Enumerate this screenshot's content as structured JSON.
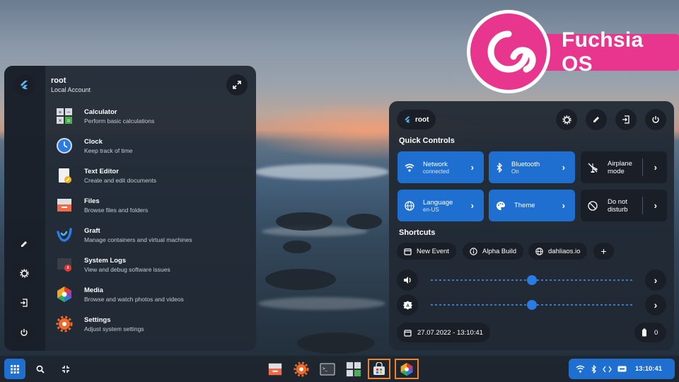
{
  "brand": {
    "logo_text": "Fuchsia OS",
    "color": "#e8368f"
  },
  "launcher": {
    "user_name": "root",
    "user_subtitle": "Local Account",
    "apps": [
      {
        "name": "Calculator",
        "desc": "Perform basic calculations",
        "icon": "calculator-icon"
      },
      {
        "name": "Clock",
        "desc": "Keep track of time",
        "icon": "clock-icon"
      },
      {
        "name": "Text Editor",
        "desc": "Create and edit documents",
        "icon": "text-editor-icon"
      },
      {
        "name": "Files",
        "desc": "Browse files and folders",
        "icon": "files-icon"
      },
      {
        "name": "Graft",
        "desc": "Manage containers and virtual machines",
        "icon": "graft-icon"
      },
      {
        "name": "System Logs",
        "desc": "View and debug software issues",
        "icon": "system-logs-icon"
      },
      {
        "name": "Media",
        "desc": "Browse and watch photos and videos",
        "icon": "media-icon"
      },
      {
        "name": "Settings",
        "desc": "Adjust system settings",
        "icon": "settings-icon"
      }
    ]
  },
  "quick_panel": {
    "user_label": "root",
    "quick_controls_title": "Quick Controls",
    "tiles": {
      "network": {
        "label": "Network",
        "sub": "connected"
      },
      "bluetooth": {
        "label": "Bluetooth",
        "sub": "On"
      },
      "airplane": {
        "label_line1": "Airplane",
        "label_line2": "mode"
      },
      "language": {
        "label": "Language",
        "sub": "en-US"
      },
      "theme": {
        "label": "Theme"
      },
      "dnd": {
        "label_line1": "Do not",
        "label_line2": "disturb"
      }
    },
    "shortcuts_title": "Shortcuts",
    "shortcuts": {
      "new_event": "New Event",
      "alpha_build": "Alpha Build",
      "dahliaos": "dahliaos.io",
      "add": "+"
    },
    "volume_level": 0.5,
    "brightness_level": 0.5,
    "datetime": "27.07.2022 - 13:10:41",
    "battery": "0"
  },
  "taskbar": {
    "tray_time": "13:10:41"
  },
  "colors": {
    "accent": "#1f6fd1",
    "panel": "#212934",
    "highlight": "#f0822b"
  }
}
